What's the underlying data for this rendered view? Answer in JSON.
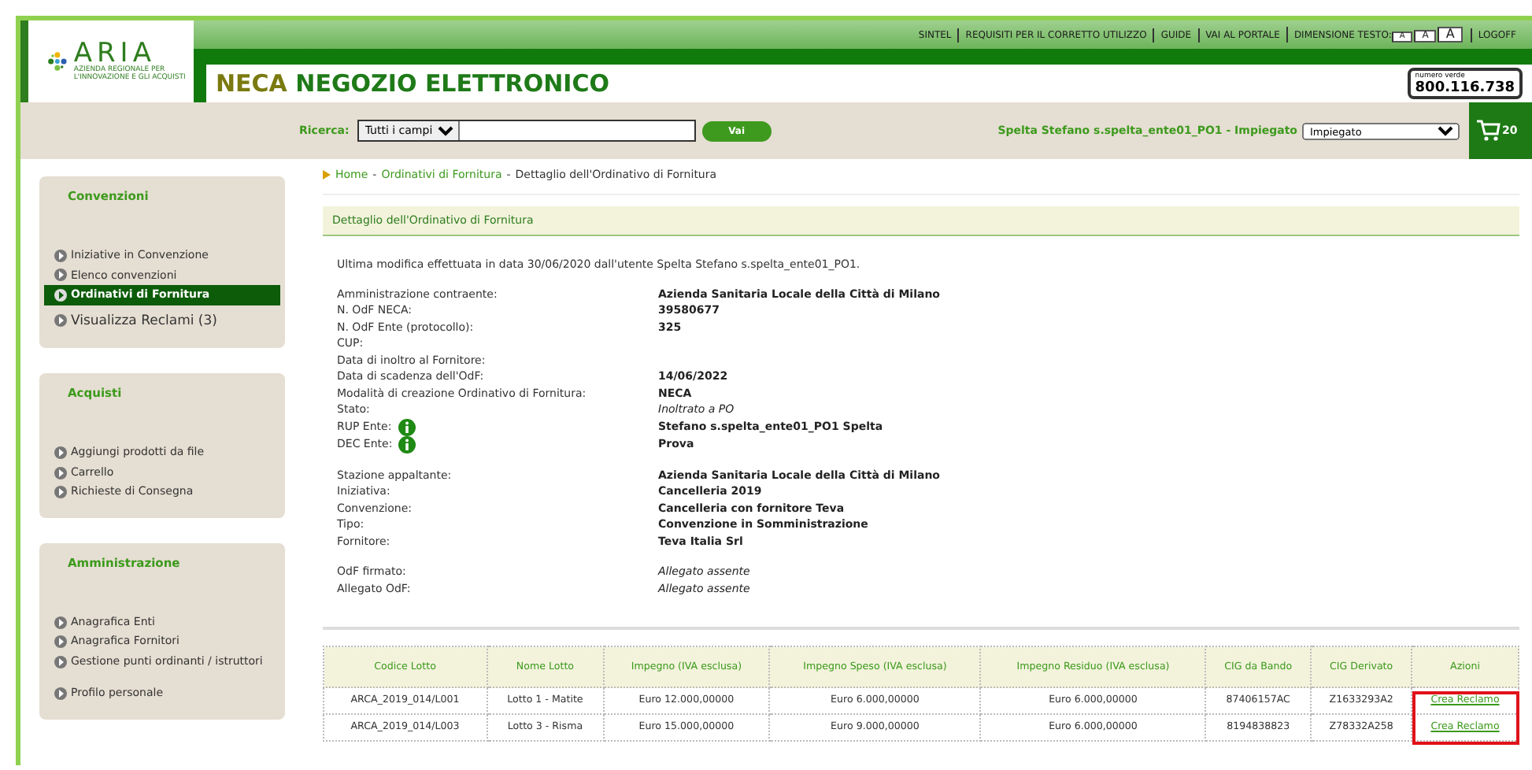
{
  "top_links": [
    "SINTEL",
    "REQUISITI PER IL CORRETTO UTILIZZO",
    "GUIDE",
    "VAI AL PORTALE"
  ],
  "text_size": {
    "label": "DIMENSIONE TESTO:",
    "sizes": [
      {
        "label": "A",
        "kind": "small"
      },
      {
        "label": "A",
        "kind": "medium"
      },
      {
        "label": "A",
        "kind": "large"
      }
    ]
  },
  "logoff": "LOGOFF",
  "logo": {
    "name": "ARIA",
    "tagline": "AZIENDA REGIONALE PER L'INNOVAZIONE E GLI ACQUISTI"
  },
  "app_title": {
    "prefix": "NECA",
    "rest": "NEGOZIO ELETTRONICO"
  },
  "hotline": {
    "label": "numero verde",
    "number": "800.116.738"
  },
  "search": {
    "label": "Ricerca:",
    "scope": "Tutti i campi",
    "button": "Vai"
  },
  "user": {
    "name": "Spelta Stefano s.spelta_ente01_PO1 - Impiegato",
    "role": "Impiegato"
  },
  "cart": {
    "count": "20"
  },
  "sidebar": [
    {
      "title": "Convenzioni",
      "items": [
        {
          "label": "Iniziative in Convenzione",
          "selected": false,
          "kind": "link"
        },
        {
          "label": "Elenco convenzioni",
          "selected": false,
          "kind": "link"
        },
        {
          "label": "Ordinativi di Fornitura",
          "selected": true,
          "kind": "link"
        },
        {
          "label": "Visualizza Reclami (3)",
          "selected": false,
          "kind": "large"
        }
      ]
    },
    {
      "title": "Acquisti",
      "items": [
        {
          "label": "Aggiungi prodotti da file",
          "selected": false,
          "kind": "link"
        },
        {
          "label": "Carrello",
          "selected": false,
          "kind": "link"
        },
        {
          "label": "Richieste di Consegna",
          "selected": false,
          "kind": "link"
        }
      ]
    },
    {
      "title": "Amministrazione",
      "items": [
        {
          "label": "Anagrafica Enti",
          "selected": false,
          "kind": "link"
        },
        {
          "label": "Anagrafica Fornitori",
          "selected": false,
          "kind": "link"
        },
        {
          "label": "Gestione punti ordinanti / istruttori",
          "selected": false,
          "kind": "link"
        },
        {
          "label": "Profilo personale",
          "selected": false,
          "kind": "spaced"
        }
      ]
    }
  ],
  "breadcrumb_separator": "-",
  "breadcrumb": [
    {
      "label": "Home",
      "kind": "link"
    },
    {
      "label": "Ordinativi di Fornitura",
      "kind": "link"
    },
    {
      "label": "Dettaglio dell'Ordinativo di Fornitura",
      "kind": "current"
    }
  ],
  "section_title": "Dettaglio dell'Ordinativo di Fornitura",
  "last_modified": "Ultima modifica effettuata in data 30/06/2020 dall'utente Spelta Stefano s.spelta_ente01_PO1.",
  "field_groups": [
    [
      {
        "label": "Amministrazione contraente:",
        "value": "Azienda Sanitaria Locale della Città di Milano"
      },
      {
        "label": "N. OdF NECA:",
        "value": "39580677"
      },
      {
        "label": "N. OdF Ente (protocollo):",
        "value": "325"
      },
      {
        "label": "CUP:"
      },
      {
        "label": "Data di inoltro al Fornitore:"
      },
      {
        "label": "Data di scadenza dell'OdF:",
        "value": "14/06/2022"
      },
      {
        "label": "Modalità di creazione Ordinativo di Fornitura:",
        "value": "NECA"
      },
      {
        "label": "Stato:",
        "value": "Inoltrato a PO",
        "italic": true
      },
      {
        "label": "RUP Ente:",
        "value": "Stefano s.spelta_ente01_PO1 Spelta",
        "info": true
      },
      {
        "label": "DEC Ente:",
        "value": "Prova",
        "info": true
      }
    ],
    [
      {
        "label": "Stazione appaltante:",
        "value": "Azienda Sanitaria Locale della Città di Milano"
      },
      {
        "label": "Iniziativa:",
        "value": "Cancelleria 2019"
      },
      {
        "label": "Convenzione:",
        "value": "Cancelleria con fornitore Teva"
      },
      {
        "label": "Tipo:",
        "value": "Convenzione in Somministrazione"
      },
      {
        "label": "Fornitore:",
        "value": "Teva Italia Srl"
      }
    ],
    [
      {
        "label": "OdF firmato:",
        "value": "Allegato assente",
        "italic": true
      },
      {
        "label": "Allegato OdF:",
        "value": "Allegato assente",
        "italic": true
      }
    ]
  ],
  "table": {
    "columns": [
      "Codice Lotto",
      "Nome Lotto",
      "Impegno (IVA esclusa)",
      "Impegno Speso (IVA esclusa)",
      "Impegno Residuo (IVA esclusa)",
      "CIG da Bando",
      "CIG Derivato",
      "Azioni"
    ],
    "rows": [
      [
        "ARCA_2019_014/L001",
        "Lotto 1 - Matite",
        "Euro 12.000,00000",
        "Euro 6.000,00000",
        "Euro 6.000,00000",
        "87406157AC",
        "Z1633293A2",
        "Crea Reclamo"
      ],
      [
        "ARCA_2019_014/L003",
        "Lotto 3 - Risma",
        "Euro 15.000,00000",
        "Euro 9.000,00000",
        "Euro 6.000,00000",
        "8194838823",
        "Z78332A258",
        "Crea Reclamo"
      ]
    ],
    "actions_highlighted": true
  }
}
